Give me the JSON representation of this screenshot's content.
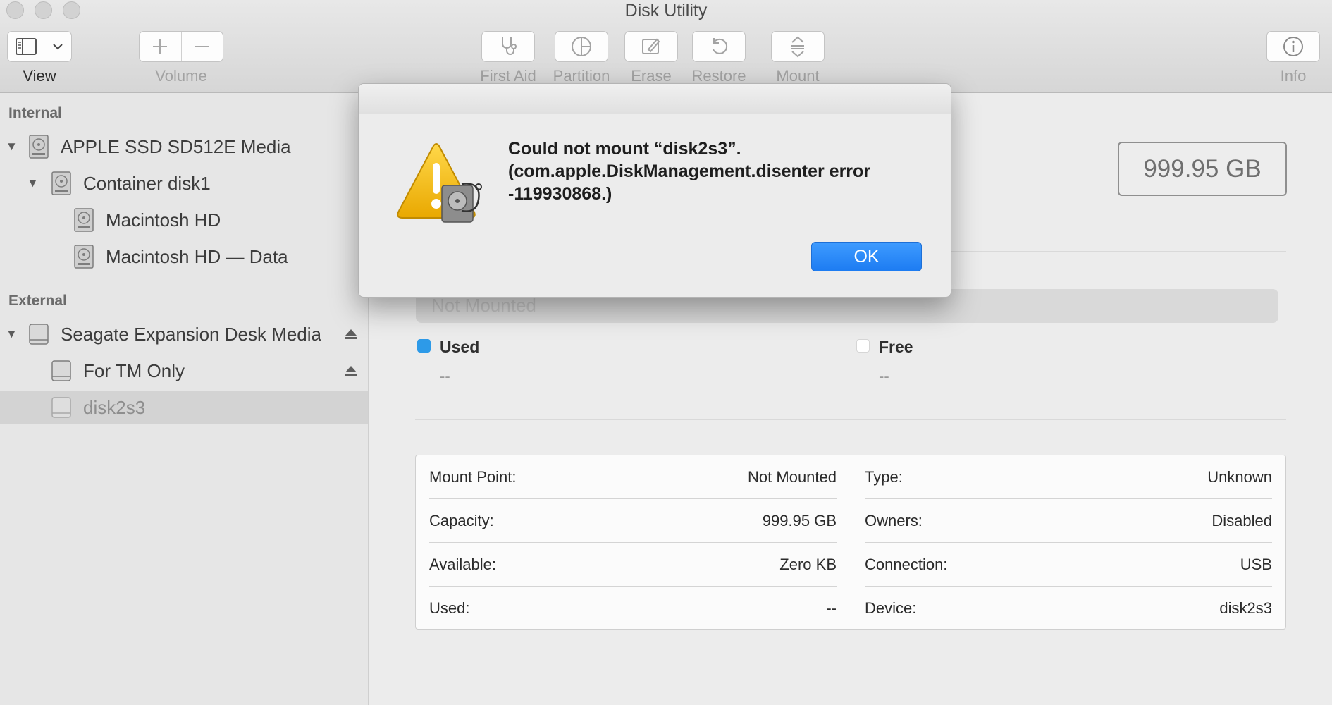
{
  "window": {
    "title": "Disk Utility"
  },
  "toolbar": {
    "view_label": "View",
    "volume_label": "Volume",
    "first_aid_label": "First Aid",
    "partition_label": "Partition",
    "erase_label": "Erase",
    "restore_label": "Restore",
    "mount_label": "Mount",
    "info_label": "Info"
  },
  "sidebar": {
    "internal_header": "Internal",
    "external_header": "External",
    "internal_items": [
      {
        "label": "APPLE SSD SD512E Media"
      },
      {
        "label": "Container disk1"
      },
      {
        "label": "Macintosh HD"
      },
      {
        "label": "Macintosh HD — Data"
      }
    ],
    "external_items": [
      {
        "label": "Seagate Expansion Desk Media"
      },
      {
        "label": "For TM Only"
      },
      {
        "label": "disk2s3",
        "selected": true
      }
    ]
  },
  "main": {
    "capacity": "999.95 GB",
    "usage_text": "Not Mounted",
    "legend": {
      "used_label": "Used",
      "used_value": "--",
      "used_color": "#2d9ae8",
      "free_label": "Free",
      "free_value": "--",
      "free_color": "#ffffff"
    },
    "details_left": [
      {
        "key": "Mount Point:",
        "value": "Not Mounted"
      },
      {
        "key": "Capacity:",
        "value": "999.95 GB"
      },
      {
        "key": "Available:",
        "value": "Zero KB"
      },
      {
        "key": "Used:",
        "value": "--"
      }
    ],
    "details_right": [
      {
        "key": "Type:",
        "value": "Unknown"
      },
      {
        "key": "Owners:",
        "value": "Disabled"
      },
      {
        "key": "Connection:",
        "value": "USB"
      },
      {
        "key": "Device:",
        "value": "disk2s3"
      }
    ]
  },
  "dialog": {
    "message": "Could not mount “disk2s3”. (com.apple.DiskManagement.disenter error -119930868.)",
    "ok_label": "OK",
    "icon": "caution-icon"
  }
}
